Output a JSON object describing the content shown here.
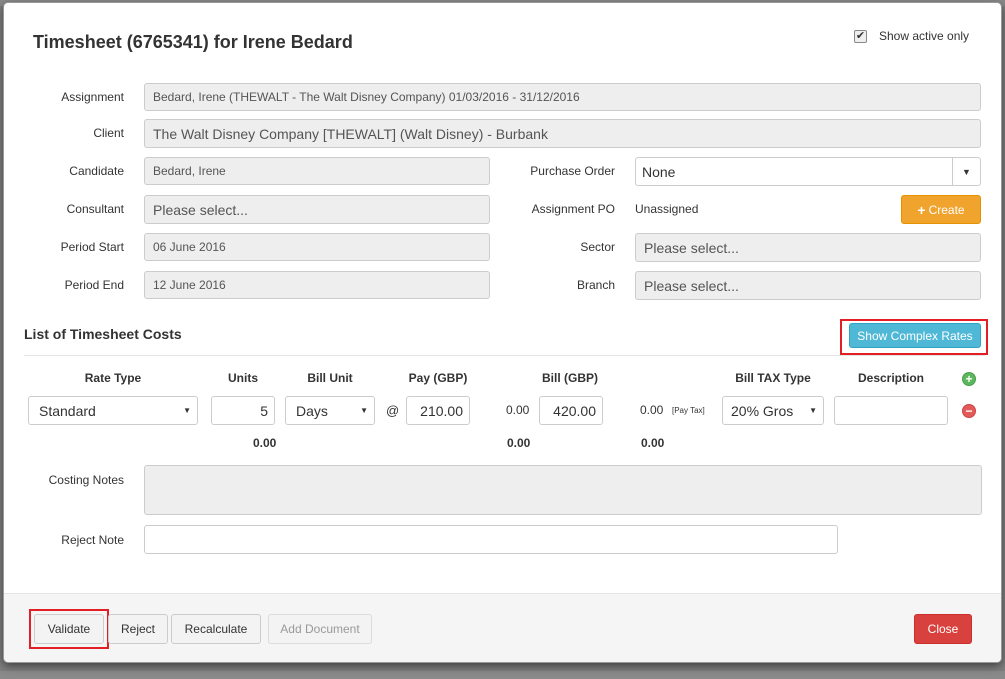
{
  "modal": {
    "title": "Timesheet (6765341) for Irene Bedard",
    "show_active_only": {
      "label": "Show active only",
      "checked": true,
      "check_glyph": "✔"
    }
  },
  "form": {
    "assignment": {
      "label": "Assignment",
      "value": "Bedard, Irene (THEWALT - The Walt Disney Company) 01/03/2016 - 31/12/2016"
    },
    "client": {
      "label": "Client",
      "value": "The Walt Disney Company [THEWALT] (Walt Disney) - Burbank"
    },
    "candidate": {
      "label": "Candidate",
      "value": "Bedard, Irene"
    },
    "consultant": {
      "label": "Consultant",
      "placeholder": "Please select..."
    },
    "period_start": {
      "label": "Period Start",
      "value": "06 June 2016"
    },
    "period_end": {
      "label": "Period End",
      "value": "12 June 2016"
    },
    "purchase_order": {
      "label": "Purchase Order",
      "value": "None",
      "caret": "▼"
    },
    "assignment_po": {
      "label": "Assignment PO",
      "value": "Unassigned"
    },
    "create_button": {
      "icon": "+",
      "label": "Create"
    },
    "sector": {
      "label": "Sector",
      "placeholder": "Please select..."
    },
    "branch": {
      "label": "Branch",
      "placeholder": "Please select..."
    }
  },
  "costs": {
    "section_title": "List of Timesheet Costs",
    "complex_rates_button": "Show Complex Rates",
    "headers": {
      "rate_type": "Rate Type",
      "units": "Units",
      "bill_unit": "Bill Unit",
      "pay": "Pay (GBP)",
      "bill": "Bill (GBP)",
      "bill_tax_type": "Bill TAX Type",
      "description": "Description"
    },
    "row": {
      "rate_type": "Standard",
      "units": "5",
      "bill_unit": "Days",
      "at_symbol": "@",
      "pay": "210.00",
      "pay_extra": "0.00",
      "bill": "420.00",
      "bill_extra": "0.00",
      "pay_tax_tag": "[Pay Tax]",
      "bill_tax_type": "20% Gros",
      "description": "",
      "dropdown_caret": "▼"
    },
    "totals": {
      "units": "0.00",
      "pay": "0.00",
      "bill": "0.00"
    },
    "add_icon": "+",
    "remove_icon": "−"
  },
  "notes": {
    "costing_notes": {
      "label": "Costing Notes",
      "value": ""
    },
    "reject_note": {
      "label": "Reject Note",
      "value": ""
    }
  },
  "footer": {
    "validate": "Validate",
    "reject": "Reject",
    "recalculate": "Recalculate",
    "add_document": "Add Document",
    "close": "Close"
  },
  "colors": {
    "accent_orange": "#f0a32d",
    "accent_teal": "#4fb8d6",
    "danger_red": "#d9413e",
    "highlight_red": "#e31e24",
    "add_green": "#5cb85c"
  }
}
